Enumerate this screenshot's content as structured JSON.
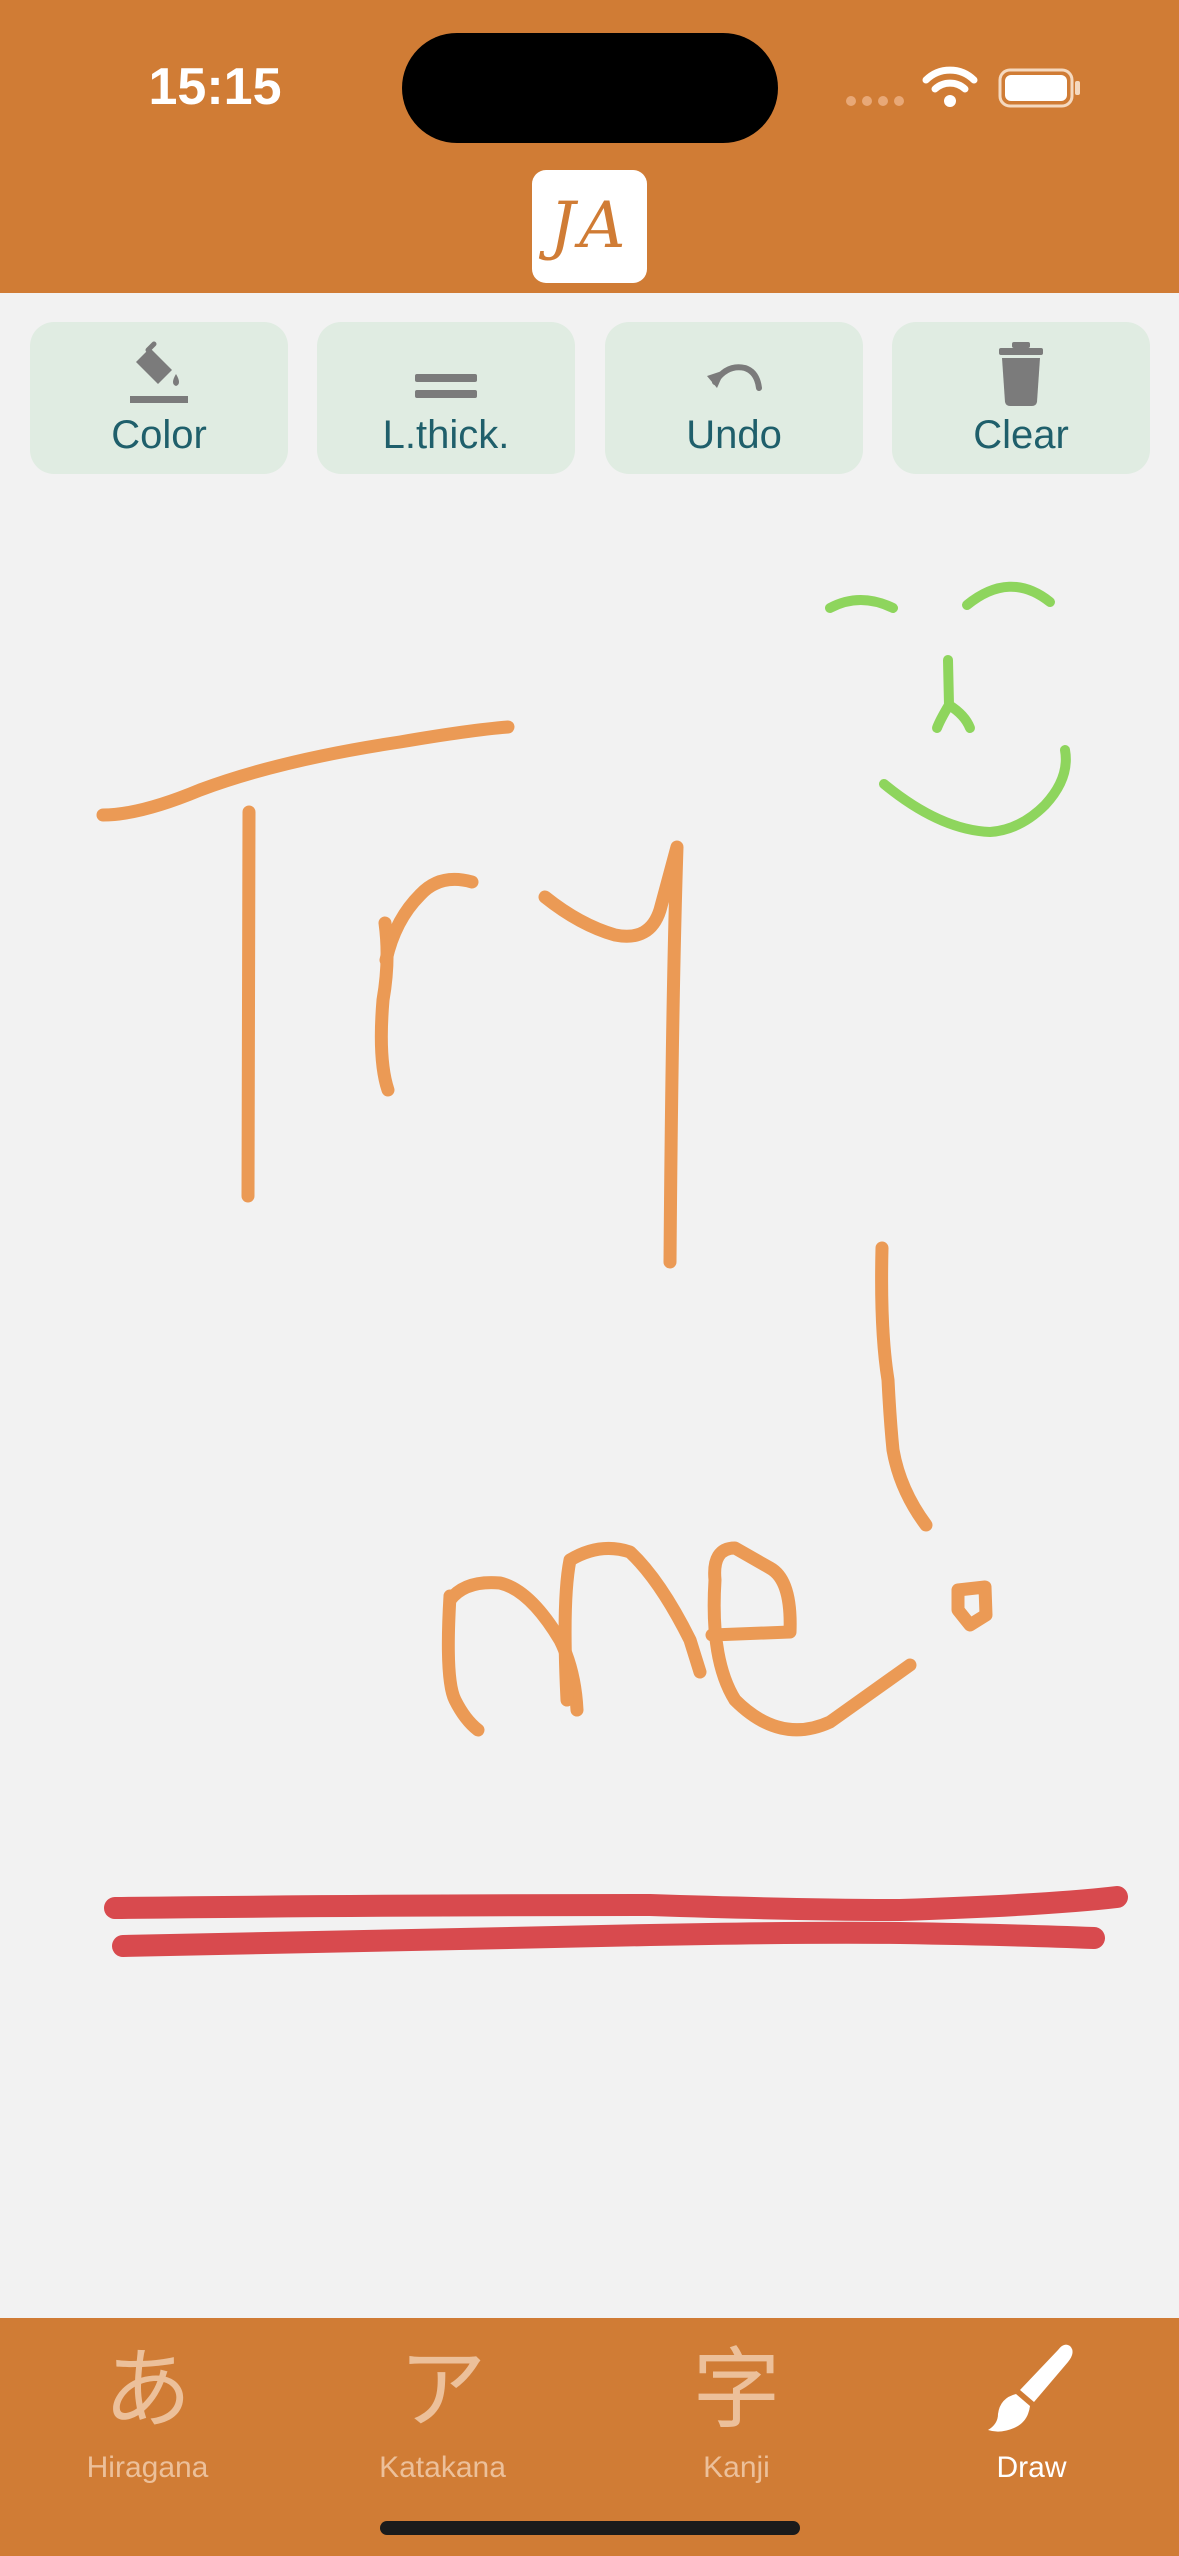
{
  "status_bar": {
    "time": "15:15"
  },
  "header": {
    "logo_text": "JA"
  },
  "toolbar": [
    {
      "label": "Color",
      "icon": "paint-bucket-icon"
    },
    {
      "label": "L.thick.",
      "icon": "line-thickness-icon"
    },
    {
      "label": "Undo",
      "icon": "undo-icon"
    },
    {
      "label": "Clear",
      "icon": "trash-icon"
    }
  ],
  "canvas": {
    "background": "#f2f2f2",
    "stroke_colors": {
      "orange": "#eb9a55",
      "green": "#8ed55d",
      "red": "#d84a4e"
    }
  },
  "tabs": [
    {
      "glyph": "あ",
      "label": "Hiragana",
      "active": false
    },
    {
      "glyph": "ア",
      "label": "Katakana",
      "active": false
    },
    {
      "glyph": "字",
      "label": "Kanji",
      "active": false
    },
    {
      "glyph": "",
      "label": "Draw",
      "active": true,
      "icon": "brush-icon"
    }
  ],
  "colors": {
    "header_bg": "#d07c35",
    "button_bg": "#e0ece2",
    "button_text": "#1f5f6b",
    "tab_inactive": "#ecc09a",
    "tab_active": "#ffffff"
  }
}
